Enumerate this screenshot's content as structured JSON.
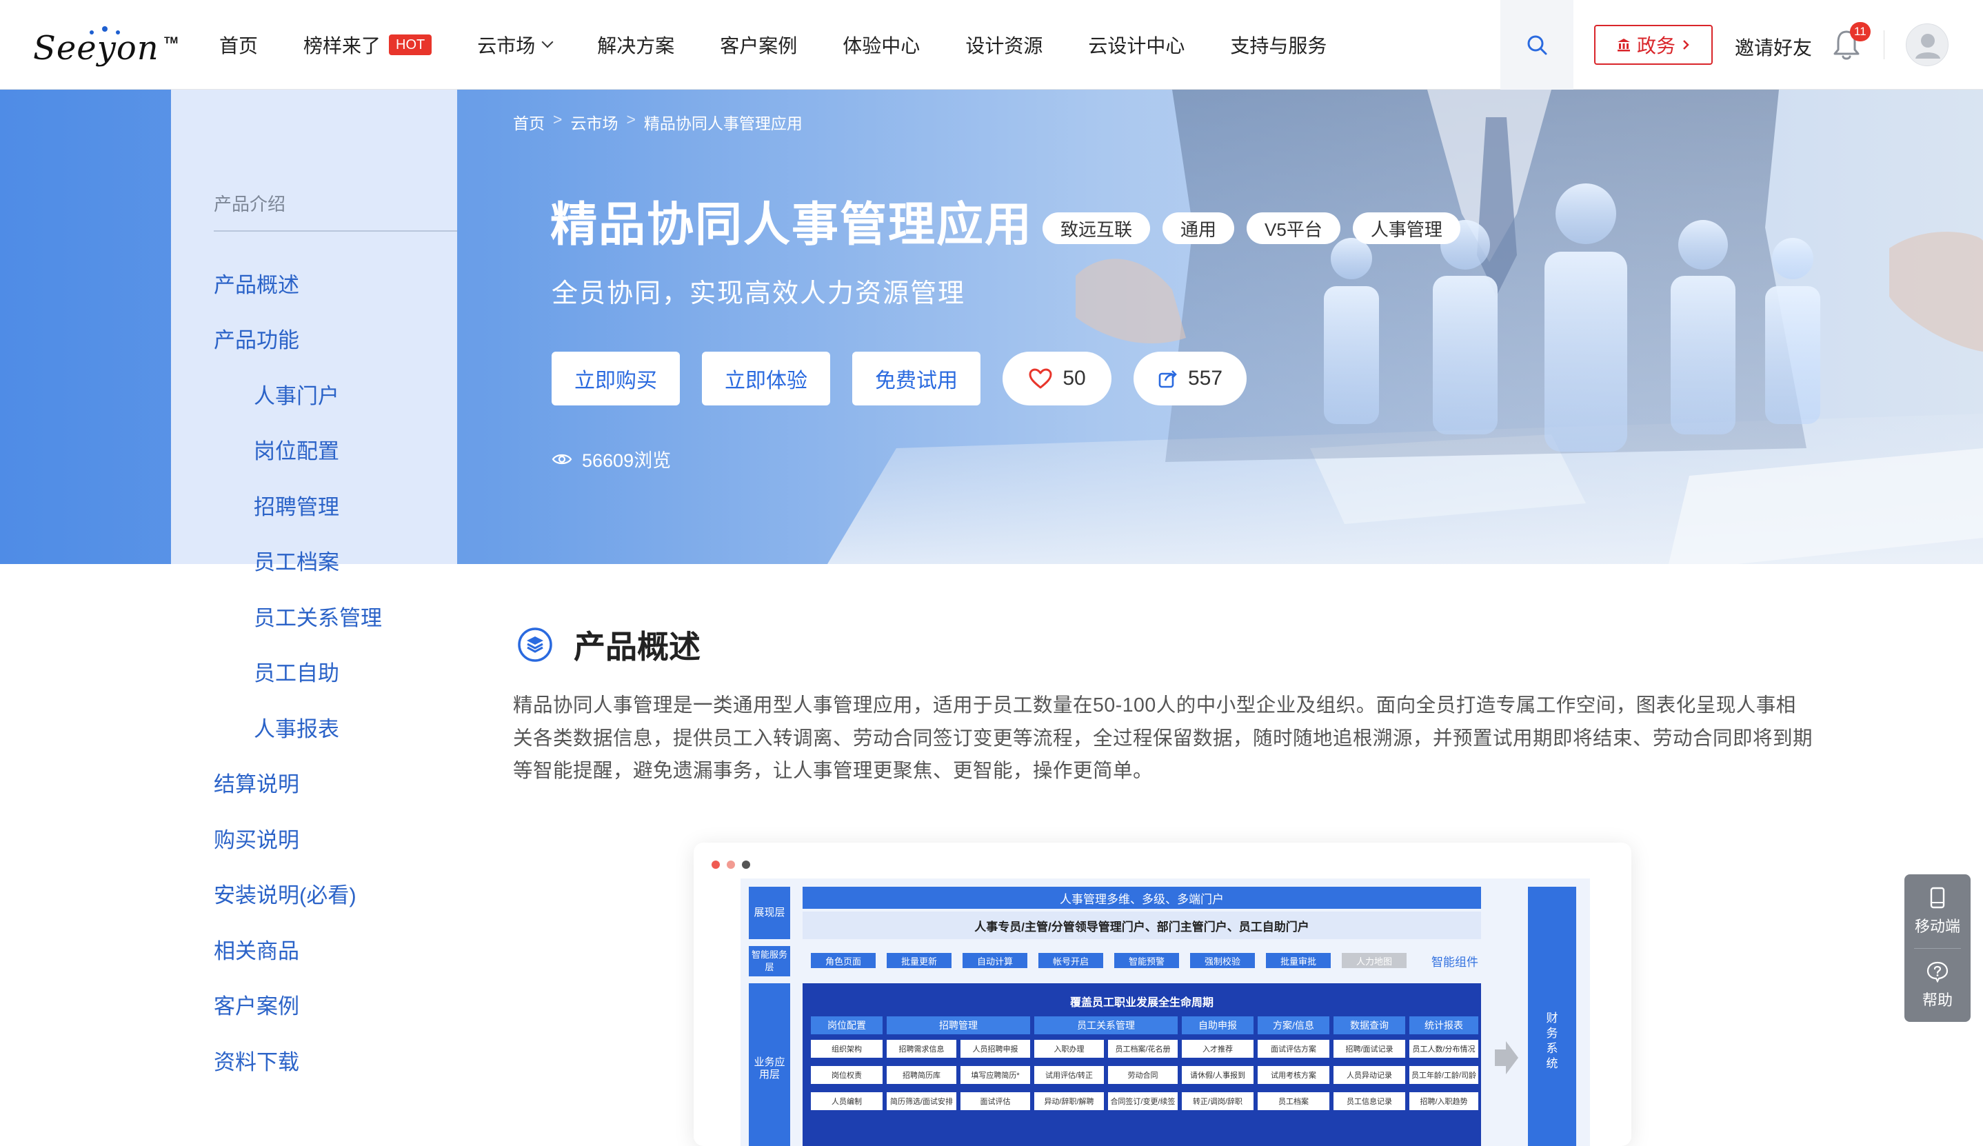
{
  "header": {
    "logo_text": "Seeyon",
    "logo_tm": "TM",
    "nav": [
      {
        "label": "首页"
      },
      {
        "label": "榜样来了",
        "badge": "HOT"
      },
      {
        "label": "云市场",
        "dropdown": true
      },
      {
        "label": "解决方案"
      },
      {
        "label": "客户案例"
      },
      {
        "label": "体验中心"
      },
      {
        "label": "设计资源"
      },
      {
        "label": "云设计中心"
      },
      {
        "label": "支持与服务"
      }
    ],
    "gov_button": "政务",
    "invite": "邀请好友",
    "notification_count": "11",
    "icons": {
      "search": "search-icon",
      "bell": "bell-icon",
      "avatar": "user-avatar-icon"
    }
  },
  "breadcrumb": [
    "首页",
    "云市场",
    "精品协同人事管理应用"
  ],
  "hero": {
    "title": "精品协同人事管理应用",
    "tags": [
      "致远互联",
      "通用",
      "V5平台",
      "人事管理"
    ],
    "subtitle": "全员协同，实现高效人力资源管理",
    "buttons": [
      "立即购买",
      "立即体验",
      "免费试用"
    ],
    "likes": "50",
    "shares": "557",
    "views": "56609浏览"
  },
  "sidebar": {
    "heading": "产品介绍",
    "items": [
      {
        "label": "产品概述",
        "level": 1
      },
      {
        "label": "产品功能",
        "level": 1
      },
      {
        "label": "人事门户",
        "level": 2
      },
      {
        "label": "岗位配置",
        "level": 2
      },
      {
        "label": "招聘管理",
        "level": 2
      },
      {
        "label": "员工档案",
        "level": 2
      },
      {
        "label": "员工关系管理",
        "level": 2
      },
      {
        "label": "员工自助",
        "level": 2
      },
      {
        "label": "人事报表",
        "level": 2
      },
      {
        "label": "结算说明",
        "level": 1
      },
      {
        "label": "购买说明",
        "level": 1
      },
      {
        "label": "安装说明(必看)",
        "level": 1
      },
      {
        "label": "相关商品",
        "level": 1
      },
      {
        "label": "客户案例",
        "level": 1
      },
      {
        "label": "资料下载",
        "level": 1
      }
    ]
  },
  "overview": {
    "title": "产品概述",
    "description": "精品协同人事管理是一类通用型人事管理应用，适用于员工数量在50-100人的中小型企业及组织。面向全员打造专属工作空间，图表化呈现人事相关各类数据信息，提供员工入转调离、劳动合同签订变更等流程，全过程保留数据，随时随地追根溯源，并预置试用期即将结束、劳动合同即将到期等智能提醒，避免遗漏事务，让人事管理更聚焦、更智能，操作更简单。"
  },
  "diagram": {
    "row_labels": [
      "展现层",
      "智能服务层",
      "业务应用层"
    ],
    "portal_bar": "人事管理多维、多级、多端门户",
    "portal_sub": "人事专员/主管/分管领导管理门户、部门主管门户、员工自助门户",
    "chips": [
      "角色页面",
      "批量更新",
      "自动计算",
      "帐号开启",
      "智能预警",
      "强制校验",
      "批量审批",
      "人力地图"
    ],
    "chips_label": "智能组件",
    "lifecycle": "覆盖员工职业发展全生命周期",
    "columns": [
      "岗位配置",
      "招聘管理",
      "员工关系管理",
      "自助申报",
      "方案/信息",
      "数据查询",
      "统计报表"
    ],
    "cells": [
      [
        "组织架构",
        "招聘需求信息",
        "人员招聘申报",
        "入职办理",
        "员工档案/花名册",
        "入才推荐",
        "面试评估方案",
        "招聘/面试记录",
        "员工人数/分布情况"
      ],
      [
        "岗位权责",
        "招聘简历库",
        "填写应聘简历*",
        "试用评估/转正",
        "劳动合同",
        "请休假/人事报到",
        "试用考核方案",
        "人员异动记录",
        "员工年龄/工龄/司龄"
      ],
      [
        "人员编制",
        "简历筛选/面试安排",
        "面试评估",
        "异动/辞职/解聘",
        "合同签订/变更/续签",
        "转正/调岗/辞职",
        "员工档案",
        "员工信息记录",
        "招聘/入职趋势"
      ]
    ],
    "side_label": "财务系统"
  },
  "float_panel": {
    "mobile": "移动端",
    "help": "帮助"
  },
  "colors": {
    "brand_blue": "#2b63c8",
    "hot_red": "#e8352b",
    "gov_red": "#d9252a",
    "hero_blue": "#4f8ce6"
  }
}
